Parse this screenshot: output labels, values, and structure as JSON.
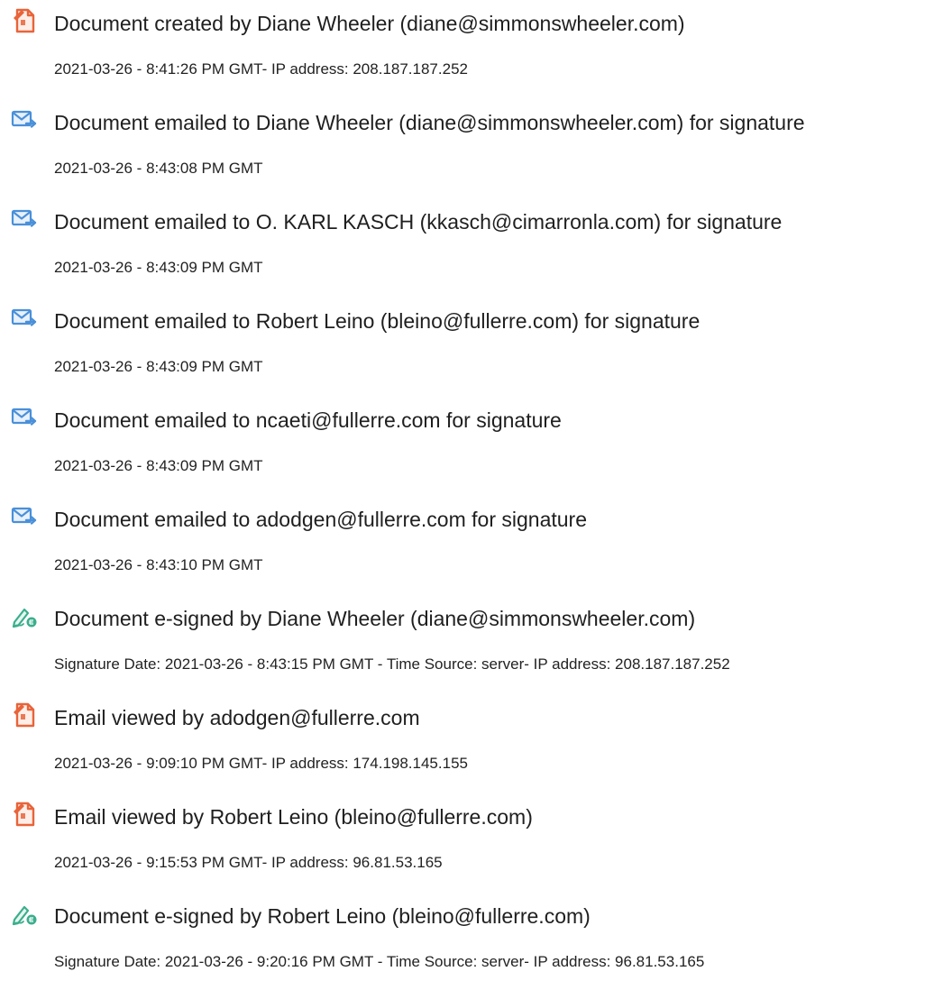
{
  "colors": {
    "created_icon": "#E8643A",
    "email_icon": "#4A90D9",
    "signed_icon": "#3BAE8C"
  },
  "events": [
    {
      "icon": "document-icon",
      "title": "Document created by Diane Wheeler (diane@simmonswheeler.com)",
      "detail": "2021-03-26 - 8:41:26 PM GMT- IP address: 208.187.187.252"
    },
    {
      "icon": "email-icon",
      "title": "Document emailed to Diane Wheeler (diane@simmonswheeler.com) for signature",
      "detail": "2021-03-26 - 8:43:08 PM GMT"
    },
    {
      "icon": "email-icon",
      "title": "Document emailed to O. KARL KASCH (kkasch@cimarronla.com) for signature",
      "detail": "2021-03-26 - 8:43:09 PM GMT"
    },
    {
      "icon": "email-icon",
      "title": "Document emailed to Robert Leino (bleino@fullerre.com) for signature",
      "detail": "2021-03-26 - 8:43:09 PM GMT"
    },
    {
      "icon": "email-icon",
      "title": "Document emailed to ncaeti@fullerre.com for signature",
      "detail": "2021-03-26 - 8:43:09 PM GMT"
    },
    {
      "icon": "email-icon",
      "title": "Document emailed to adodgen@fullerre.com for signature",
      "detail": "2021-03-26 - 8:43:10 PM GMT"
    },
    {
      "icon": "esign-icon",
      "title": "Document e-signed by Diane Wheeler (diane@simmonswheeler.com)",
      "detail": "Signature Date: 2021-03-26 - 8:43:15 PM GMT - Time Source: server- IP address: 208.187.187.252"
    },
    {
      "icon": "document-icon",
      "title": "Email viewed by adodgen@fullerre.com",
      "detail": "2021-03-26 - 9:09:10 PM GMT- IP address: 174.198.145.155"
    },
    {
      "icon": "document-icon",
      "title": "Email viewed by Robert Leino (bleino@fullerre.com)",
      "detail": "2021-03-26 - 9:15:53 PM GMT- IP address: 96.81.53.165"
    },
    {
      "icon": "esign-icon",
      "title": "Document e-signed by Robert Leino (bleino@fullerre.com)",
      "detail": "Signature Date: 2021-03-26 - 9:20:16 PM GMT - Time Source: server- IP address: 96.81.53.165"
    }
  ]
}
